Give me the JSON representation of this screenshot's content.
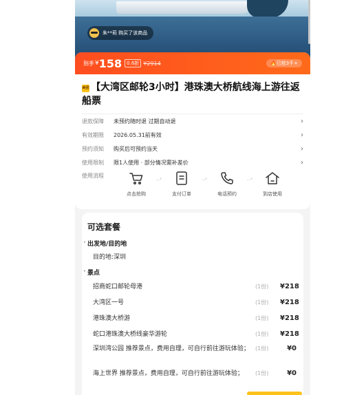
{
  "hero": {
    "buyer_text": "朱**莉 购买了该商品"
  },
  "price": {
    "prefix": "到手",
    "currency": "¥",
    "value": "158",
    "discount": "0.6折",
    "original": "¥2914",
    "sold": "已抢3千+"
  },
  "product": {
    "tag": "美团",
    "title": "【大湾区邮轮3小时】港珠澳大桥航线海上游往返船票"
  },
  "info": [
    {
      "label": "退款保障",
      "value": "未预约随时退 过期自动退"
    },
    {
      "label": "有效期限",
      "value": "2026.05.31前有效"
    },
    {
      "label": "预约须知",
      "value": "购买后可预约当天"
    },
    {
      "label": "使用限制",
      "value": "限1人使用 · 部分情况需补差价"
    }
  ],
  "flow": {
    "label": "使用流程",
    "steps": [
      {
        "icon": "cart-icon",
        "label": "点击抢购"
      },
      {
        "icon": "order-icon",
        "label": "支付订单"
      },
      {
        "icon": "phone-icon",
        "label": "电话预约"
      },
      {
        "icon": "home-icon",
        "label": "到店使用"
      }
    ]
  },
  "packages": {
    "title": "可选套餐",
    "section1": "出发地/目的地",
    "destination": "目的地:深圳",
    "section2": "景点",
    "items": [
      {
        "name": "招商蛇口邮轮母港",
        "qty": "(1份)",
        "price": "¥218"
      },
      {
        "name": "大湾区一号",
        "qty": "(1份)",
        "price": "¥218"
      },
      {
        "name": "港珠澳大桥游",
        "qty": "(1份)",
        "price": "¥218"
      },
      {
        "name": "蛇口港珠澳大桥线豪华游轮",
        "qty": "(1份)",
        "price": "¥218"
      },
      {
        "name": "深圳湾公园 推荐景点，费用自理，可自行前往游玩体验；",
        "qty": "(1份)",
        "price": "¥0"
      },
      {
        "name": "海上世界 推荐景点，费用自理，可自行前往游玩体验；",
        "qty": "(1份)",
        "price": "¥0"
      }
    ]
  },
  "colors": {
    "accent": "#ff5a1f",
    "tag": "#ffc21a"
  }
}
